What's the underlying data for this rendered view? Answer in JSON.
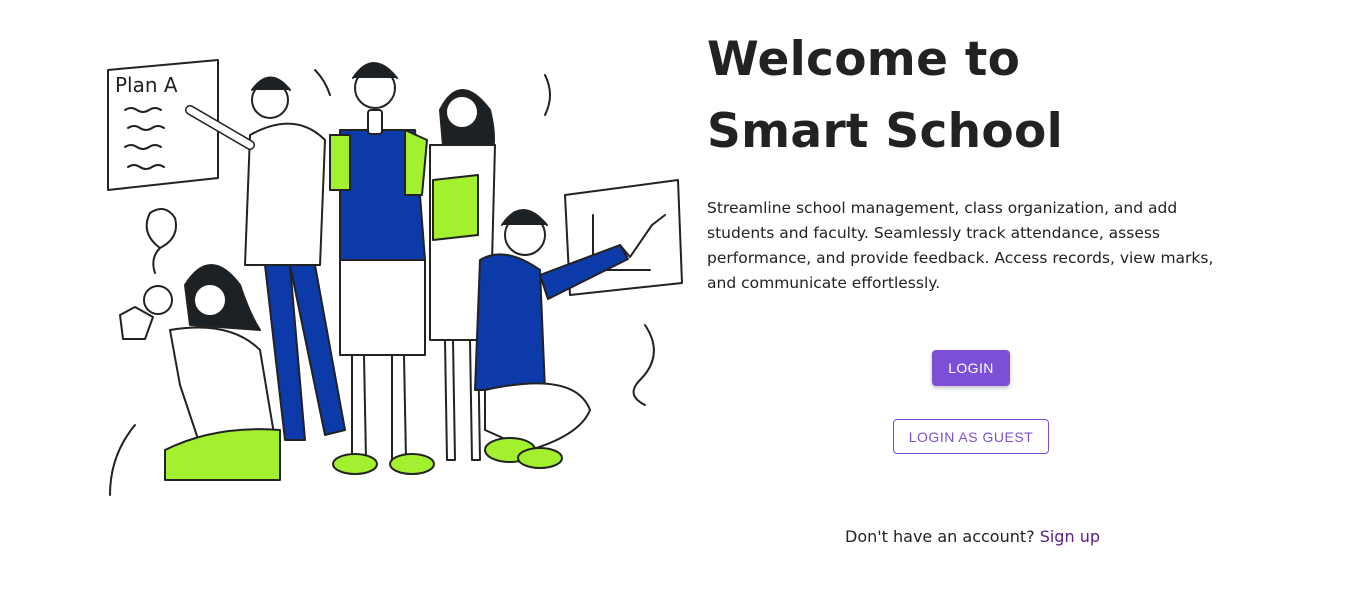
{
  "hero": {
    "title_line1": "Welcome to",
    "title_line2": "Smart School",
    "description": "Streamline school management, class organization, and add students and faculty. Seamlessly track attendance, assess performance, and provide feedback. Access records, view marks, and communicate effortlessly."
  },
  "actions": {
    "login_label": "LOGIN",
    "guest_label": "LOGIN AS GUEST"
  },
  "signup": {
    "prompt": "Don't have an account?",
    "link_label": "Sign up"
  },
  "illustration": {
    "board_text": "Plan A"
  },
  "colors": {
    "primary": "#7c4fd6",
    "text": "#222222",
    "link": "#5b1c8a",
    "blue": "#0c3aa8",
    "lime": "#a3f02e"
  }
}
